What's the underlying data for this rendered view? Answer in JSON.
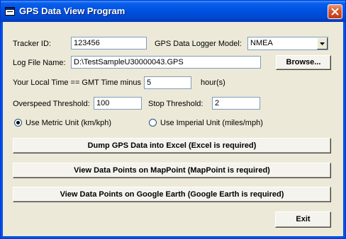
{
  "window": {
    "title": "GPS Data View Program"
  },
  "form": {
    "tracker_id_label": "Tracker ID:",
    "tracker_id_value": "123456",
    "model_label": "GPS Data Logger Model:",
    "model_value": "NMEA",
    "log_file_label": "Log File Name:",
    "log_file_value": "D:\\TestSampleU30000043.GPS",
    "browse_label": "Browse...",
    "local_time_label": "Your Local Time == GMT Time minus",
    "local_time_value": "5",
    "hours_label": "hour(s)",
    "overspeed_label": "Overspeed Threshold:",
    "overspeed_value": "100",
    "stop_label": "Stop Threshold:",
    "stop_value": "2",
    "metric_label": "Use Metric Unit (km/kph)",
    "metric_selected": true,
    "imperial_label": "Use Imperial Unit (miles/mph)",
    "imperial_selected": false
  },
  "actions": {
    "dump_excel": "Dump GPS Data into Excel (Excel is required)",
    "view_mappoint": "View Data Points on MapPoint (MapPoint is required)",
    "view_google_earth": "View Data Points on Google Earth (Google Earth is required)",
    "exit": "Exit"
  },
  "icons": {
    "app": "app-window-icon",
    "close": "close-icon",
    "dropdown": "chevron-down-icon"
  }
}
